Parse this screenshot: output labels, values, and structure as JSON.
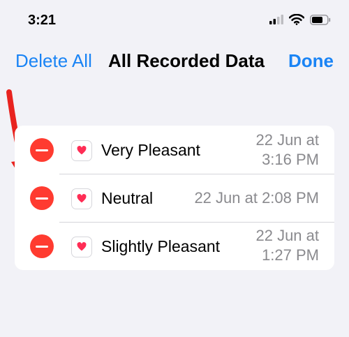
{
  "status_bar": {
    "time": "3:21",
    "icons": [
      "signal-icon",
      "wifi-icon",
      "battery-icon"
    ]
  },
  "nav": {
    "delete_all": "Delete All",
    "title": "All Recorded Data",
    "done": "Done"
  },
  "records": [
    {
      "label": "Very Pleasant",
      "date_line1": "22 Jun at",
      "date_line2": "3:16 PM"
    },
    {
      "label": "Neutral",
      "date_line1": "22 Jun at 2:08 PM"
    },
    {
      "label": "Slightly Pleasant",
      "date_line1": "22 Jun at",
      "date_line2": "1:27 PM"
    }
  ],
  "colors": {
    "background": "#f2f2f7",
    "accent": "#1a84f5",
    "delete_red": "#ff3b30",
    "heart_pink": "#ff2d55",
    "date_gray": "#8a8a8e"
  }
}
